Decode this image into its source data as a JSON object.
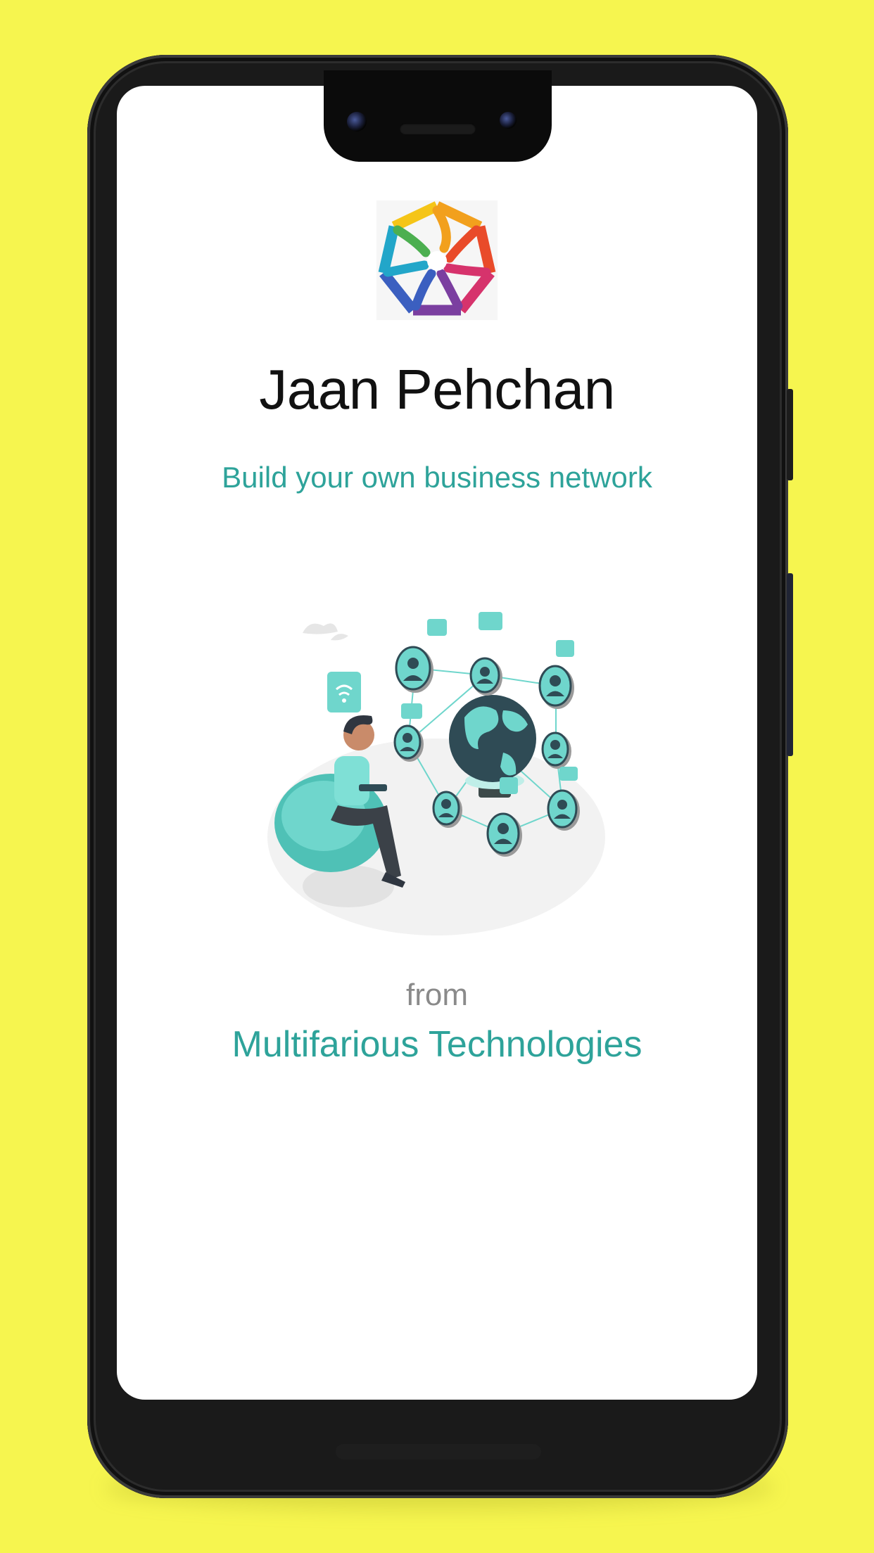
{
  "app": {
    "title": "Jaan Pehchan",
    "tagline": "Build your own business network",
    "from_label": "from",
    "company": "Multifarious Technologies"
  },
  "colors": {
    "background": "#f6f54f",
    "accent": "#2ea39a",
    "title": "#111111",
    "muted": "#8a8a8a"
  },
  "icons": [
    "app-logo",
    "network-illustration"
  ]
}
